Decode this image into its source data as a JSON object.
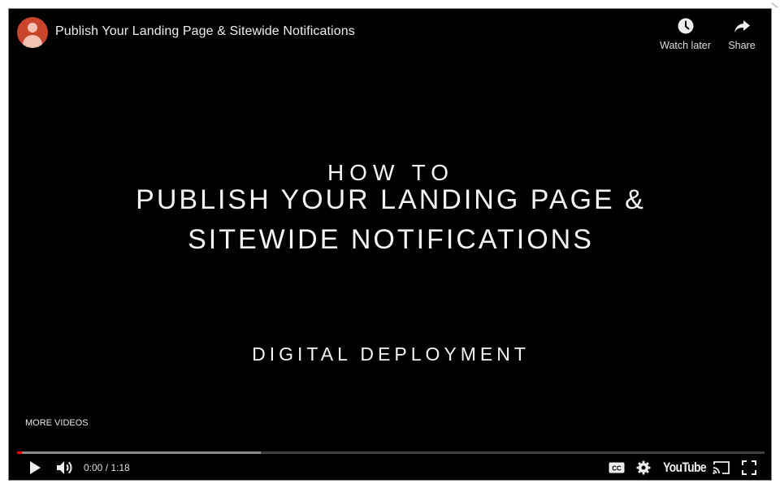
{
  "video": {
    "title": "Publish Your Landing Page & Sitewide Notifications",
    "channel_avatar_icon": "avatar-icon",
    "actions": [
      {
        "label": "Watch later",
        "icon": "clock-icon"
      },
      {
        "label": "Share",
        "icon": "share-arrow-icon"
      }
    ]
  },
  "title_card": {
    "how_to": "HOW TO",
    "line1": "PUBLISH YOUR LANDING PAGE &",
    "line2": "SITEWIDE NOTIFICATIONS",
    "subtitle": "DIGITAL DEPLOYMENT"
  },
  "overlay": {
    "more_videos": "MORE VIDEOS"
  },
  "controls": {
    "current_time": "0:00",
    "duration": "1:18",
    "time_display": "0:00 / 1:18",
    "progress_played_fraction": 0.006,
    "progress_buffered_fraction": 0.326,
    "play_icon": "play-icon",
    "volume_icon": "volume-icon",
    "cc_label": "CC",
    "settings_icon": "gear-icon",
    "logo_text": "YouTube",
    "cast_icon": "cast-icon",
    "fullscreen_icon": "fullscreen-icon"
  },
  "colors": {
    "played": "#ff0000",
    "buffered": "#8a8a8a",
    "avatar": "#c9462c"
  }
}
